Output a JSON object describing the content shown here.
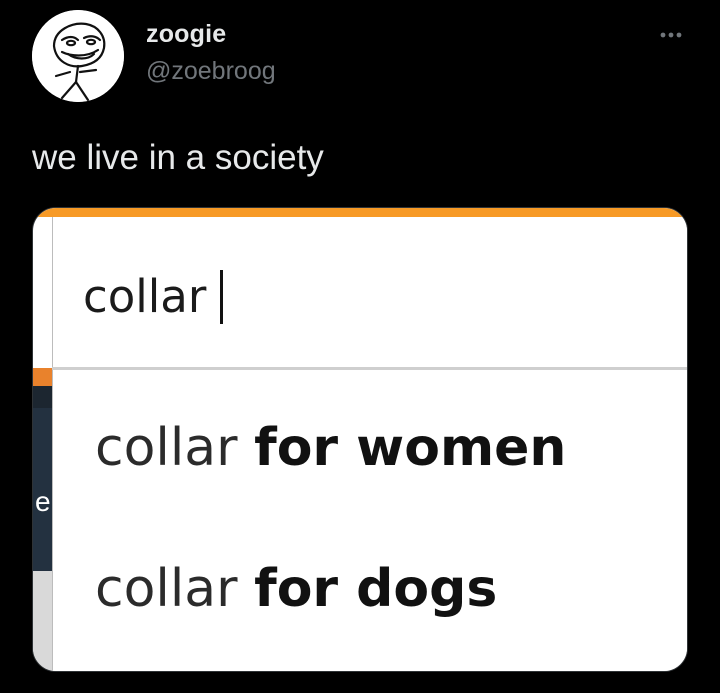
{
  "tweet": {
    "author": {
      "display_name": "zoogie",
      "handle": "@zoebroog",
      "avatar_icon": "troll-face-doodle-avatar"
    },
    "more_icon": "more-horizontal-icon",
    "text": "we live in a society"
  },
  "screenshot": {
    "search": {
      "value": "collar"
    },
    "suggestions": [
      {
        "typed": "collar",
        "completion": "for women"
      },
      {
        "typed": "collar",
        "completion": "for dogs"
      }
    ],
    "peek_text": "e",
    "colors": {
      "accent_orange": "#f79a26",
      "panel_dark": "#233140"
    }
  }
}
